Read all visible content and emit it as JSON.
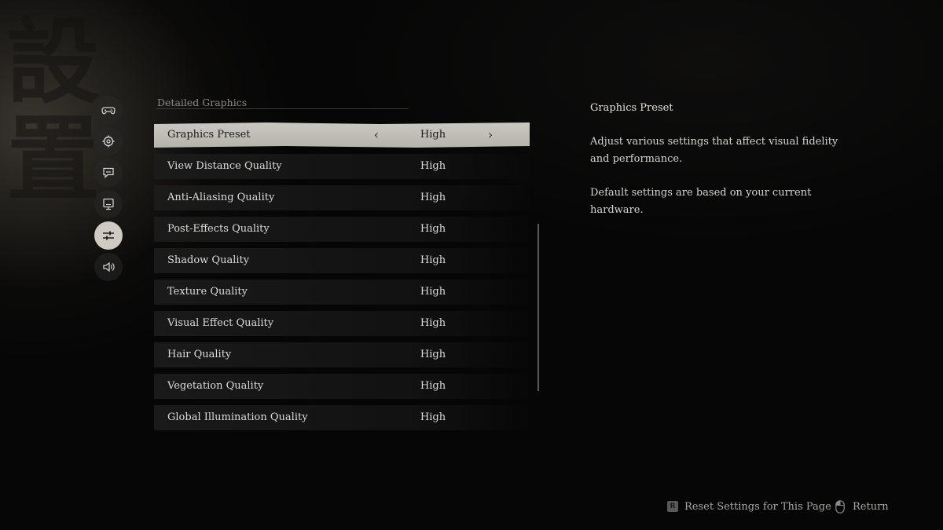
{
  "section": {
    "title": "Detailed Graphics"
  },
  "calligraphy": "設置",
  "nav": [
    {
      "icon": "gamepad-icon",
      "active": false
    },
    {
      "icon": "settings-gear-icon",
      "active": false
    },
    {
      "icon": "chat-icon",
      "active": false
    },
    {
      "icon": "display-icon",
      "active": false
    },
    {
      "icon": "sliders-icon",
      "active": true
    },
    {
      "icon": "speaker-icon",
      "active": false
    }
  ],
  "settings": [
    {
      "label": "Graphics Preset",
      "value": "High",
      "selected": true
    },
    {
      "label": "View Distance Quality",
      "value": "High"
    },
    {
      "label": "Anti-Aliasing Quality",
      "value": "High"
    },
    {
      "label": "Post-Effects Quality",
      "value": "High"
    },
    {
      "label": "Shadow Quality",
      "value": "High"
    },
    {
      "label": "Texture Quality",
      "value": "High"
    },
    {
      "label": "Visual Effect Quality",
      "value": "High"
    },
    {
      "label": "Hair Quality",
      "value": "High"
    },
    {
      "label": "Vegetation Quality",
      "value": "High"
    },
    {
      "label": "Global Illumination Quality",
      "value": "High"
    }
  ],
  "description": {
    "title": "Graphics Preset",
    "paragraph1": "Adjust various settings that affect visual fidelity and performance.",
    "paragraph2": "Default settings are based on your current hardware."
  },
  "footer": {
    "reset_key": "R",
    "reset_label": "Reset Settings for This Page",
    "return_label": "Return"
  }
}
